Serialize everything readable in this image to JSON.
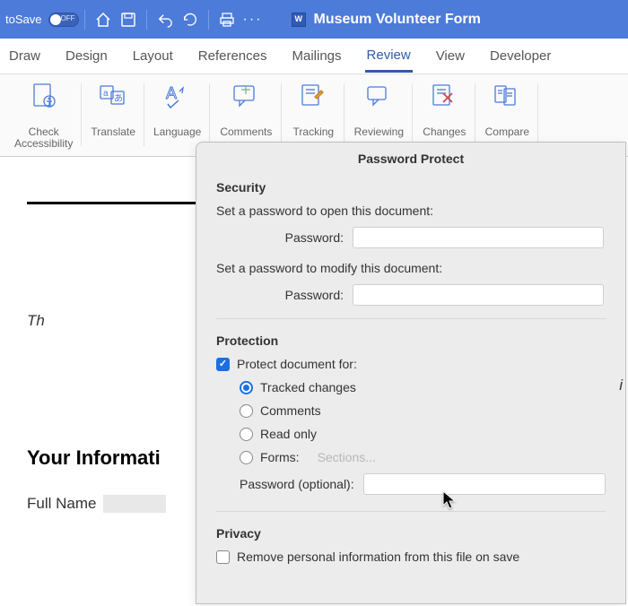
{
  "titlebar": {
    "autosave_label": "toSave",
    "toggle_text": "OFF",
    "doc_title": "Museum Volunteer Form"
  },
  "ribbon": {
    "tabs": [
      "Draw",
      "Design",
      "Layout",
      "References",
      "Mailings",
      "Review",
      "View",
      "Developer"
    ],
    "active_tab": "Review",
    "groups": {
      "accessibility": "Check\nAccessibility",
      "translate": "Translate",
      "language": "Language",
      "comments": "Comments",
      "tracking": "Tracking",
      "reviewing": "Reviewing",
      "changes": "Changes",
      "compare": "Compare"
    }
  },
  "document": {
    "preview_text": "Th",
    "preview_text_right": "i",
    "heading": "Your Informati",
    "field_label": "Full Name"
  },
  "dialog": {
    "title": "Password Protect",
    "security": {
      "heading": "Security",
      "open_label": "Set a password to open this document:",
      "modify_label": "Set a password to modify this document:",
      "password_label": "Password:"
    },
    "protection": {
      "heading": "Protection",
      "protect_for": "Protect document for:",
      "options": {
        "tracked": "Tracked changes",
        "comments": "Comments",
        "readonly": "Read only",
        "forms": "Forms:"
      },
      "sections_btn": "Sections...",
      "pw_optional": "Password (optional):"
    },
    "privacy": {
      "heading": "Privacy",
      "remove_pii": "Remove personal information from this file on save"
    }
  }
}
